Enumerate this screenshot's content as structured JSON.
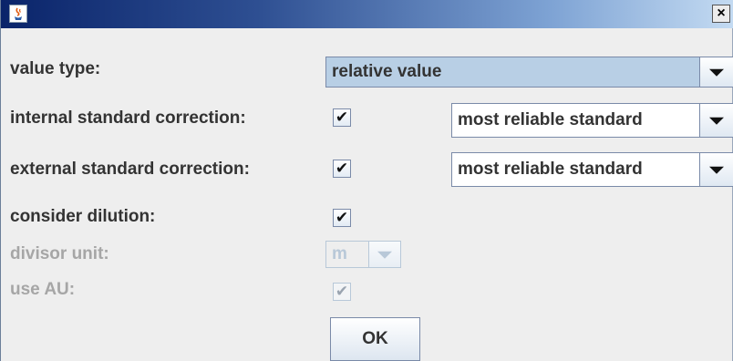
{
  "titlebar": {
    "app_icon": "java-cup-icon",
    "close_label": "×"
  },
  "form": {
    "value_type": {
      "label": "value type:",
      "selected": "relative value"
    },
    "internal_standard": {
      "label": "internal standard correction:",
      "checked": true,
      "selected": "most reliable standard"
    },
    "external_standard": {
      "label": "external standard correction:",
      "checked": true,
      "selected": "most reliable standard"
    },
    "consider_dilution": {
      "label": "consider dilution:",
      "checked": true
    },
    "divisor_unit": {
      "label": "divisor unit:",
      "selected": "m",
      "enabled": false
    },
    "use_au": {
      "label": "use AU:",
      "checked": true,
      "enabled": false
    }
  },
  "ok_button": {
    "label": "OK"
  },
  "check_glyph": "✔"
}
